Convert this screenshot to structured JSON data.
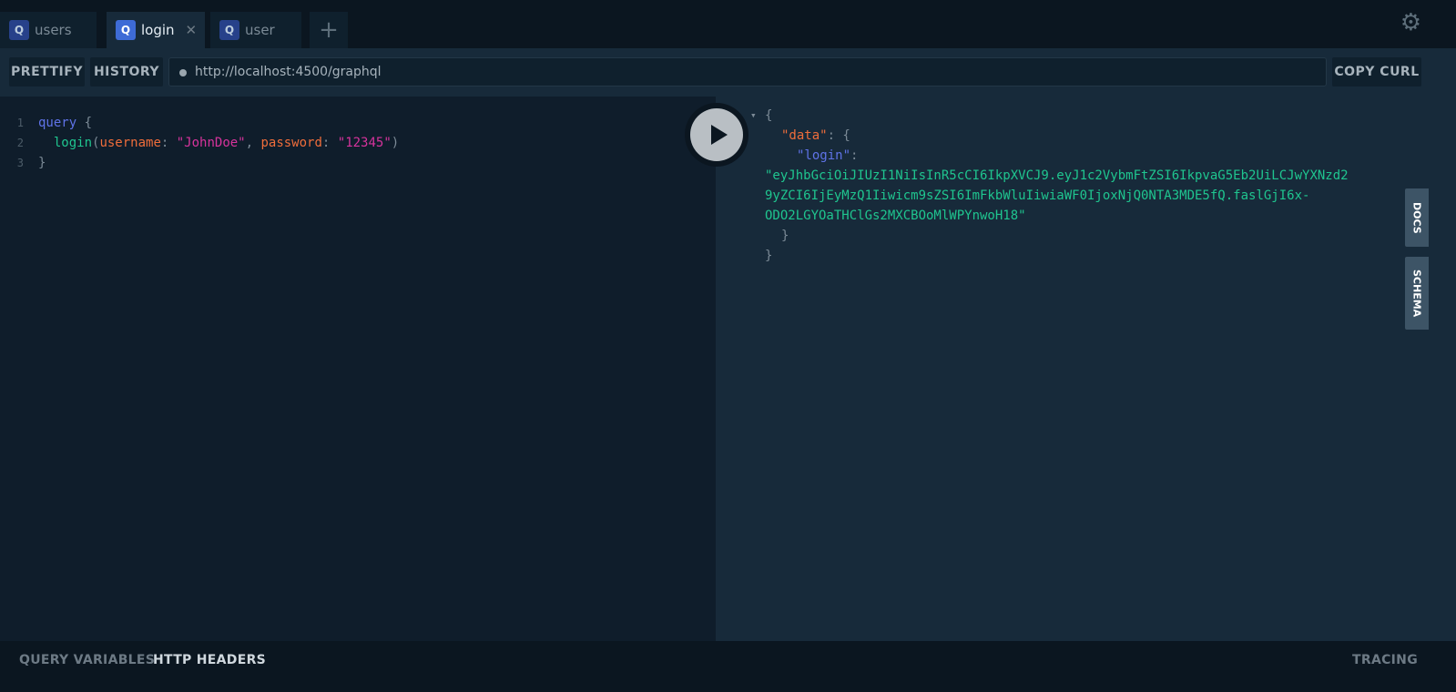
{
  "tabs": [
    {
      "label": "users",
      "active": false
    },
    {
      "label": "login",
      "active": true
    },
    {
      "label": "user",
      "active": false
    }
  ],
  "tab_icon": "Q",
  "toolbar": {
    "prettify": "PRETTIFY",
    "history": "HISTORY",
    "url": "http://localhost:4500/graphql",
    "copy_curl": "COPY CURL"
  },
  "editor": {
    "line_numbers": [
      "1",
      "2",
      "3"
    ],
    "line1": {
      "kw": "query",
      "brace": " {"
    },
    "line2": {
      "field": "login",
      "p1": "(",
      "a1": "username",
      "c1": ": ",
      "v1": "\"JohnDoe\"",
      "sep": ", ",
      "a2": "password",
      "c2": ": ",
      "v2": "\"12345\"",
      "p2": ")"
    },
    "line3": "}"
  },
  "result": {
    "open": "{",
    "data_key": "\"data\"",
    "colon": ": {",
    "login_key": "\"login\"",
    "colon2": ":",
    "token_lines": [
      "\"eyJhbGciOiJIUzI1NiIsInR5cCI6IkpXVCJ9.eyJ1c2VybmFtZSI6IkpvaG5Eb2UiLCJwYXNzd2",
      "9yZCI6IjEyMzQ1Iiwicm9sZSI6ImFkbWluIiwiaWF0IjoxNjQ0NTA3MDE5fQ.faslGjI6x-",
      "ODO2LGYOaTHClGs2MXCBOoMlWPYnwoH18\""
    ],
    "close_inner": "}",
    "close_outer": "}",
    "collapse_arrow": "▾"
  },
  "side": {
    "docs": "DOCS",
    "schema": "SCHEMA"
  },
  "bottom": {
    "query_variables": "QUERY VARIABLES",
    "http_headers": "HTTP HEADERS",
    "tracing": "TRACING"
  },
  "colors": {
    "accent": "#3e6bd6",
    "string": "#1fc58f",
    "key": "#ef6d3b"
  }
}
